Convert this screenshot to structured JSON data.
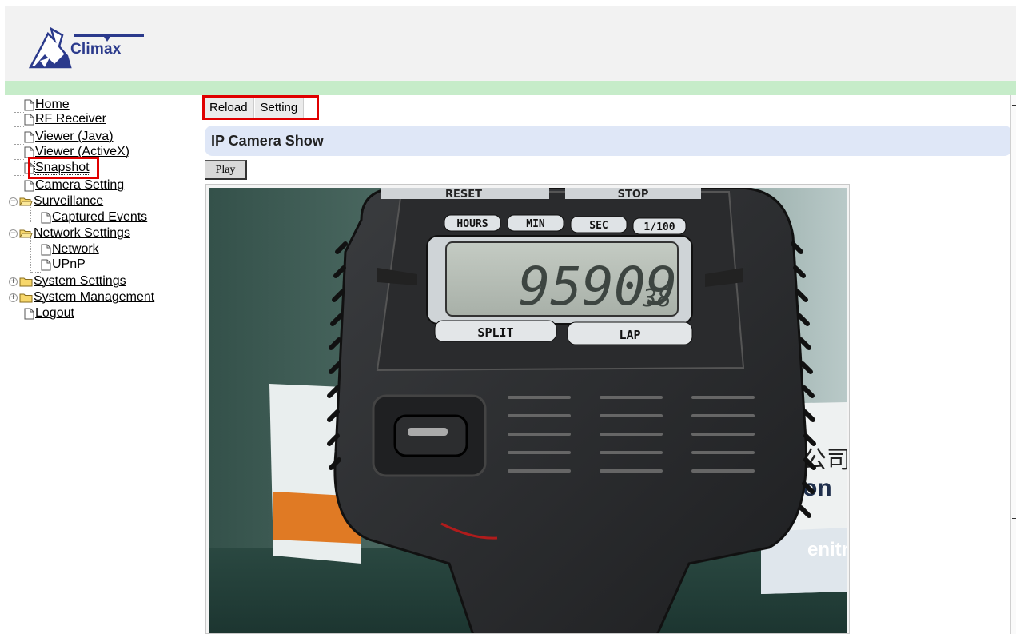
{
  "header": {
    "logo_text": "Climax"
  },
  "nav": {
    "items": [
      {
        "label": "Home",
        "type": "page"
      },
      {
        "label": "RF Receiver",
        "type": "page"
      },
      {
        "label": "Viewer (Java)",
        "type": "page"
      },
      {
        "label": "Viewer (ActiveX)",
        "type": "page"
      },
      {
        "label": "Snapshot",
        "type": "page",
        "highlighted": true
      },
      {
        "label": "Camera Setting",
        "type": "page"
      },
      {
        "label": "Surveillance",
        "type": "folder",
        "expanded": true
      },
      {
        "label": "Captured Events",
        "type": "page"
      },
      {
        "label": "Network Settings",
        "type": "folder",
        "expanded": true
      },
      {
        "label": "Network",
        "type": "page"
      },
      {
        "label": "UPnP",
        "type": "page"
      },
      {
        "label": "System Settings",
        "type": "folder",
        "expanded": false
      },
      {
        "label": "System Management",
        "type": "folder",
        "expanded": false
      },
      {
        "label": "Logout",
        "type": "page"
      }
    ]
  },
  "toolbar": {
    "reload_label": "Reload",
    "setting_label": "Setting"
  },
  "main": {
    "title": "IP Camera Show",
    "play_label": "Play"
  },
  "camera": {
    "top_labels": [
      "RESET",
      "STOP"
    ],
    "unit_labels": [
      "HOURS",
      "MIN",
      "SEC",
      "1/100"
    ],
    "lcd_main": "95909",
    "lcd_small": "38",
    "bottom_labels": [
      "SPLIT",
      "LAP"
    ],
    "box_text": [
      "公司",
      "on",
      "enitro"
    ]
  },
  "colors": {
    "highlight": "#e00000",
    "header_bg": "#f2f2f2",
    "header_bar": "#c6ecc9",
    "title_bg": "#dfe7f7",
    "logo_blue": "#2b3a8c"
  }
}
